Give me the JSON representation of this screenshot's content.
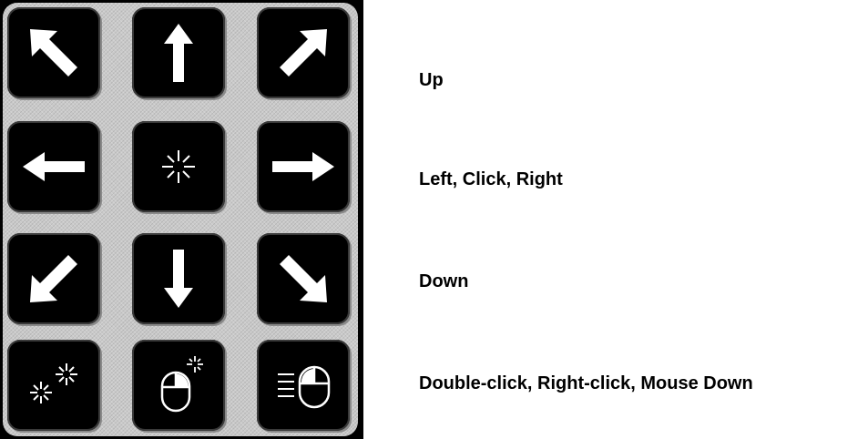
{
  "keypad": {
    "rows": [
      {
        "keys": [
          "arrow-up-left-icon",
          "arrow-up-icon",
          "arrow-up-right-icon"
        ]
      },
      {
        "keys": [
          "arrow-left-icon",
          "click-sparkle-icon",
          "arrow-right-icon"
        ]
      },
      {
        "keys": [
          "arrow-down-left-icon",
          "arrow-down-icon",
          "arrow-down-right-icon"
        ]
      },
      {
        "keys": [
          "double-click-sparkle-icon",
          "mouse-right-click-icon",
          "mouse-down-motion-icon"
        ]
      }
    ],
    "colors": {
      "panel": "#c9c9c9",
      "key": "#000000",
      "glyph": "#ffffff"
    }
  },
  "labels": {
    "row1": "Up",
    "row2": "Left, Click, Right",
    "row3": "Down",
    "row4": "Double-click, Right-click, Mouse Down"
  }
}
